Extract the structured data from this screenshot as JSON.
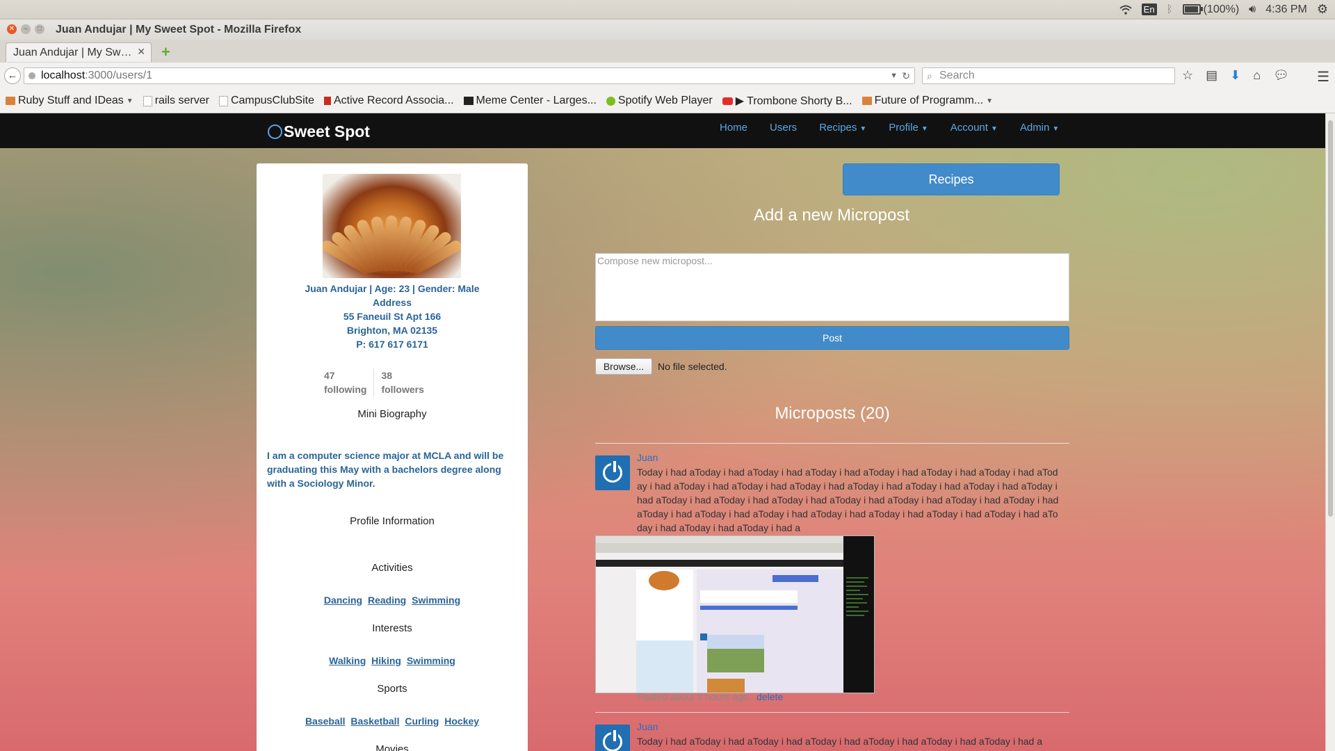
{
  "os": {
    "keyboard": "En",
    "battery": "(100%)",
    "battery_level": 1.0,
    "time": "4:36 PM"
  },
  "window": {
    "title": "Juan Andujar | My Sweet Spot - Mozilla Firefox"
  },
  "tab": {
    "label": "Juan Andujar | My Sw…"
  },
  "nav": {
    "url_host": "localhost",
    "url_path": ":3000/users/1",
    "search_placeholder": "Search"
  },
  "bookmarks": [
    {
      "label": "Ruby Stuff and IDeas",
      "icon": "folder-icon",
      "dropdown": true
    },
    {
      "label": "rails server",
      "icon": "page-icon"
    },
    {
      "label": "CampusClubSite",
      "icon": "page-icon"
    },
    {
      "label": "Active Record Associa...",
      "icon": "rails-icon"
    },
    {
      "label": "Meme Center - Larges...",
      "icon": "meme-icon"
    },
    {
      "label": "Spotify Web Player",
      "icon": "spotify-icon"
    },
    {
      "label": "▶ Trombone Shorty B...",
      "icon": "youtube-icon"
    },
    {
      "label": "Future of Programm...",
      "icon": "folder-icon",
      "dropdown": true
    }
  ],
  "site": {
    "brand": "Sweet Spot",
    "links": [
      "Home",
      "Users",
      "Recipes",
      "Profile",
      "Account",
      "Admin"
    ]
  },
  "profile": {
    "name_line": "Juan Andujar | Age: 23 | Gender: Male",
    "address_label": "Address",
    "street": "55 Faneuil St Apt 166",
    "city": "Brighton, MA 02135",
    "phone": "P: 617 617 6171",
    "following_count": "47",
    "following_label": "following",
    "followers_count": "38",
    "followers_label": "followers",
    "bio_heading": "Mini Biography",
    "bio": "I am a computer science major at MCLA and will be graduating this May with a bachelors degree along with a Sociology Minor.",
    "info_heading": "Profile Information",
    "activities_heading": "Activities",
    "activities": [
      "Dancing",
      "Reading",
      "Swimming"
    ],
    "interests_heading": "Interests",
    "interests": [
      "Walking",
      "Hiking",
      "Swimming"
    ],
    "sports_heading": "Sports",
    "sports": [
      "Baseball",
      "Basketball",
      "Curling",
      "Hockey"
    ],
    "movies_heading": "Movies"
  },
  "main": {
    "recipes_button": "Recipes",
    "add_title": "Add a new Micropost",
    "compose_placeholder": "Compose new micropost...",
    "post_button": "Post",
    "browse_button": "Browse...",
    "file_status": "No file selected.",
    "microposts_title": "Microposts (20)"
  },
  "microposts": [
    {
      "user": "Juan",
      "body": "Today i had aToday i had aToday i had aToday i had aToday i had aToday i had aToday i had aToday i had aToday i had aToday i had aToday i had aToday i had aToday i had aToday i had aToday i had aToday i had aToday i had aToday i had aToday i had aToday i had aToday i had aToday i had aToday i had aToday i had aToday i had aToday i had aToday i had aToday i had aToday i had aToday i had aToday i had aToday i had a",
      "meta": "Posted about 3 hours ago.",
      "delete": "delete"
    },
    {
      "user": "Juan",
      "body": "Today i had aToday i had aToday i had aToday i had aToday i had aToday i had aToday i had a"
    }
  ]
}
